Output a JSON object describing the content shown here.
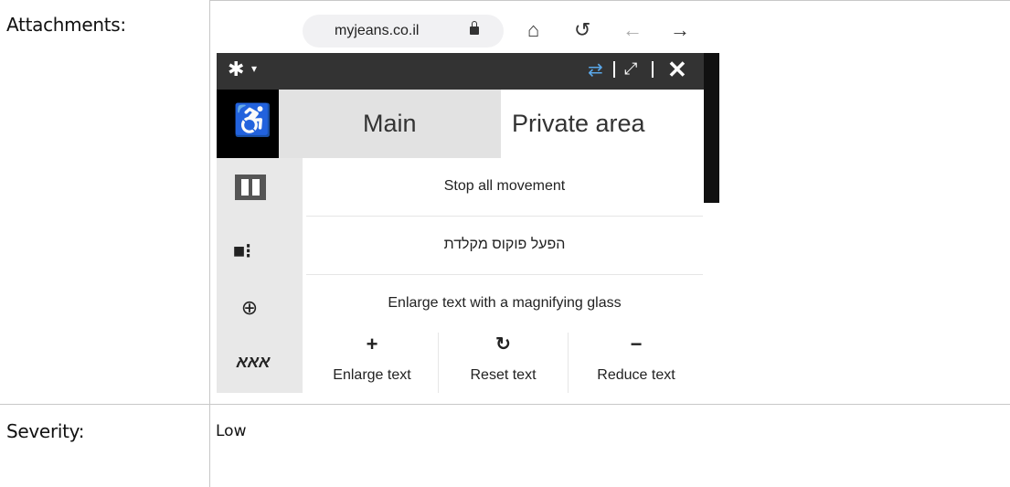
{
  "document": {
    "attachments_label": "Attachments:",
    "severity_label": "Severity:",
    "severity_value": "Low"
  },
  "screenshot": {
    "url": "myjeans.co.il",
    "icons": {
      "lock": "lock-icon",
      "home": "home-icon",
      "reload": "reload-icon",
      "back": "arrow-left-icon",
      "forward": "arrow-right-icon",
      "settings": "gear-icon",
      "swap": "swap-icon",
      "expand": "expand-icon",
      "close": "close-icon",
      "accessibility": "wheelchair-icon",
      "pause": "pause-icon",
      "focus": "keyboard-focus-icon",
      "magnify": "zoom-in-icon",
      "text_size": "text-size-icon"
    },
    "tabs": {
      "main": "Main",
      "private": "Private area"
    },
    "options": [
      "Stop all movement",
      "הפעל פוקוס מקלדת",
      "Enlarge text with a magnifying glass"
    ],
    "text_controls": {
      "enlarge": "Enlarge text",
      "reset": "Reset text",
      "reduce": "Reduce text"
    },
    "side_text_icon": "אאא",
    "colors": {
      "dark_bar": "#333333",
      "swap_icon": "#5aa7e8",
      "tab_main_bg": "#e2e2e2"
    }
  }
}
